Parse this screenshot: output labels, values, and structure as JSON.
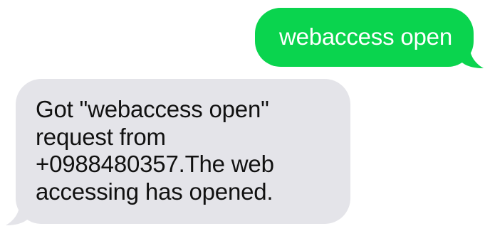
{
  "conversation": {
    "sent_message": {
      "text": "webaccess open",
      "color": "#0ad44e"
    },
    "received_message": {
      "lines": [
        "Got \"webaccess open\"",
        "request from",
        "+0988480357.The web",
        "accessing has opened."
      ],
      "color": "#e4e4e9"
    }
  }
}
